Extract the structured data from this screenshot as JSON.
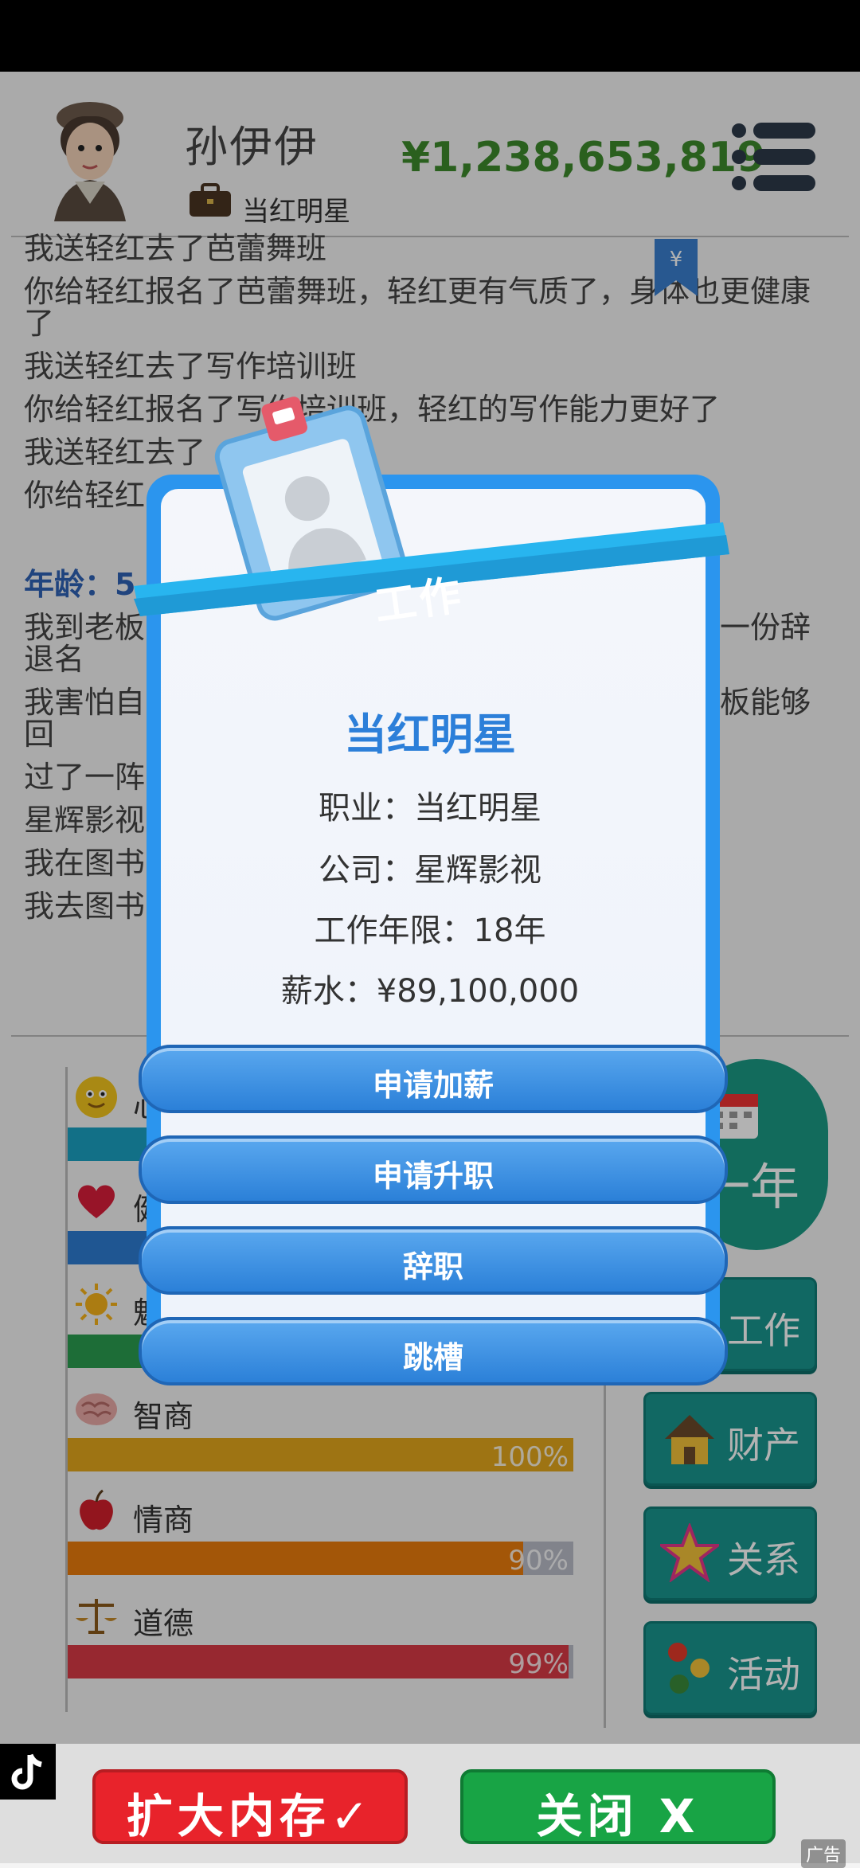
{
  "header": {
    "name": "孙伊伊",
    "job": "当红明星",
    "money": "¥1,238,653,819"
  },
  "log": [
    "我送轻红去了芭蕾舞班",
    "你给轻红报名了芭蕾舞班，轻红更有气质了，身体也更健康了",
    "我送轻红去了写作培训班",
    "你给轻红报名了写作培训班，轻红的写作能力更好了",
    "我送轻红去了",
    "你给轻红"
  ],
  "age_label": "年龄：5",
  "log2": [
    "我到老板…………………………………………出现在一份辞退名",
    "我害怕自…………………………………………希望老板能够回",
    "过了一阵…………………………………………场",
    "星辉影视",
    "我在图书",
    "我去图书"
  ],
  "stats": [
    {
      "label": "心",
      "icon": "smiley-icon",
      "value": 0.97,
      "color": "#1ba1c2",
      "pct": ""
    },
    {
      "label": "健",
      "icon": "heart-icon",
      "value": 0.95,
      "color": "#2d7bd2",
      "pct": ""
    },
    {
      "label": "魅",
      "icon": "sun-icon",
      "value": 0.96,
      "color": "#2a9d4f",
      "pct": ""
    },
    {
      "label": "智商",
      "icon": "brain-icon",
      "value": 1.0,
      "color": "#e3a61c",
      "pct": "100%"
    },
    {
      "label": "情商",
      "icon": "apple-icon",
      "value": 0.9,
      "color": "#ea7c0c",
      "pct": "90%"
    },
    {
      "label": "道德",
      "icon": "scale-icon",
      "value": 0.99,
      "color": "#d83a45",
      "pct": "99%"
    }
  ],
  "side_buttons": {
    "next_year": "一年",
    "work": "工作",
    "property": "财产",
    "relation": "关系",
    "activity": "活动"
  },
  "modal": {
    "banner": "工作",
    "title": "当红明星",
    "occupation": "职业：当红明星",
    "company": "公司：星辉影视",
    "years": "工作年限：18年",
    "salary": "薪水：¥89,100,000",
    "actions": [
      "申请加薪",
      "申请升职",
      "辞职",
      "跳槽"
    ]
  },
  "ad": {
    "btn_expand": "扩大内存✓",
    "btn_close": "关闭 X",
    "tag": "广告"
  }
}
